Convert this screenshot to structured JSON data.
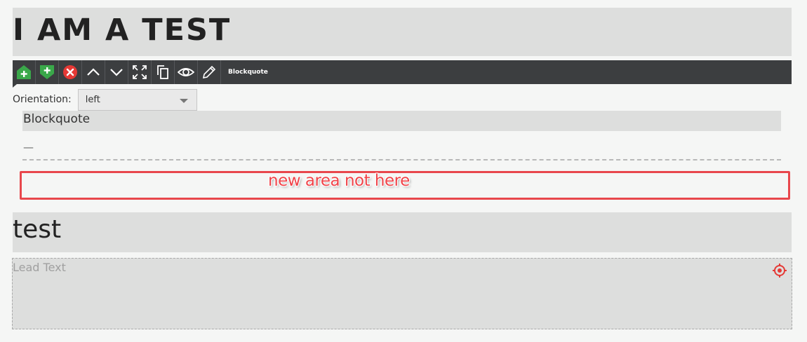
{
  "heading": {
    "text": "I AM A TEST"
  },
  "toolbar": {
    "buttons": [
      {
        "icon": "add-above-icon",
        "color": "#3aa84a"
      },
      {
        "icon": "add-below-icon",
        "color": "#3aa84a"
      },
      {
        "icon": "delete-icon",
        "color": "#e53935"
      },
      {
        "icon": "move-up-icon"
      },
      {
        "icon": "move-down-icon"
      },
      {
        "icon": "fullscreen-icon"
      },
      {
        "icon": "copy-icon"
      },
      {
        "icon": "preview-icon"
      },
      {
        "icon": "edit-icon"
      }
    ],
    "label": "Blockquote"
  },
  "orientation": {
    "label": "Orientation:",
    "value": "left"
  },
  "blockquote": {
    "text": "Blockquote",
    "citation": "—"
  },
  "annotation": {
    "text": "new area not here",
    "color": "#e8474c"
  },
  "test_block": {
    "text": "test"
  },
  "lead": {
    "placeholder": "Lead Text"
  },
  "colors": {
    "toolbar_bg": "#3c3e40",
    "block_bg": "#dddedd",
    "page_bg": "#f5f6f5",
    "target": "#e53935"
  }
}
